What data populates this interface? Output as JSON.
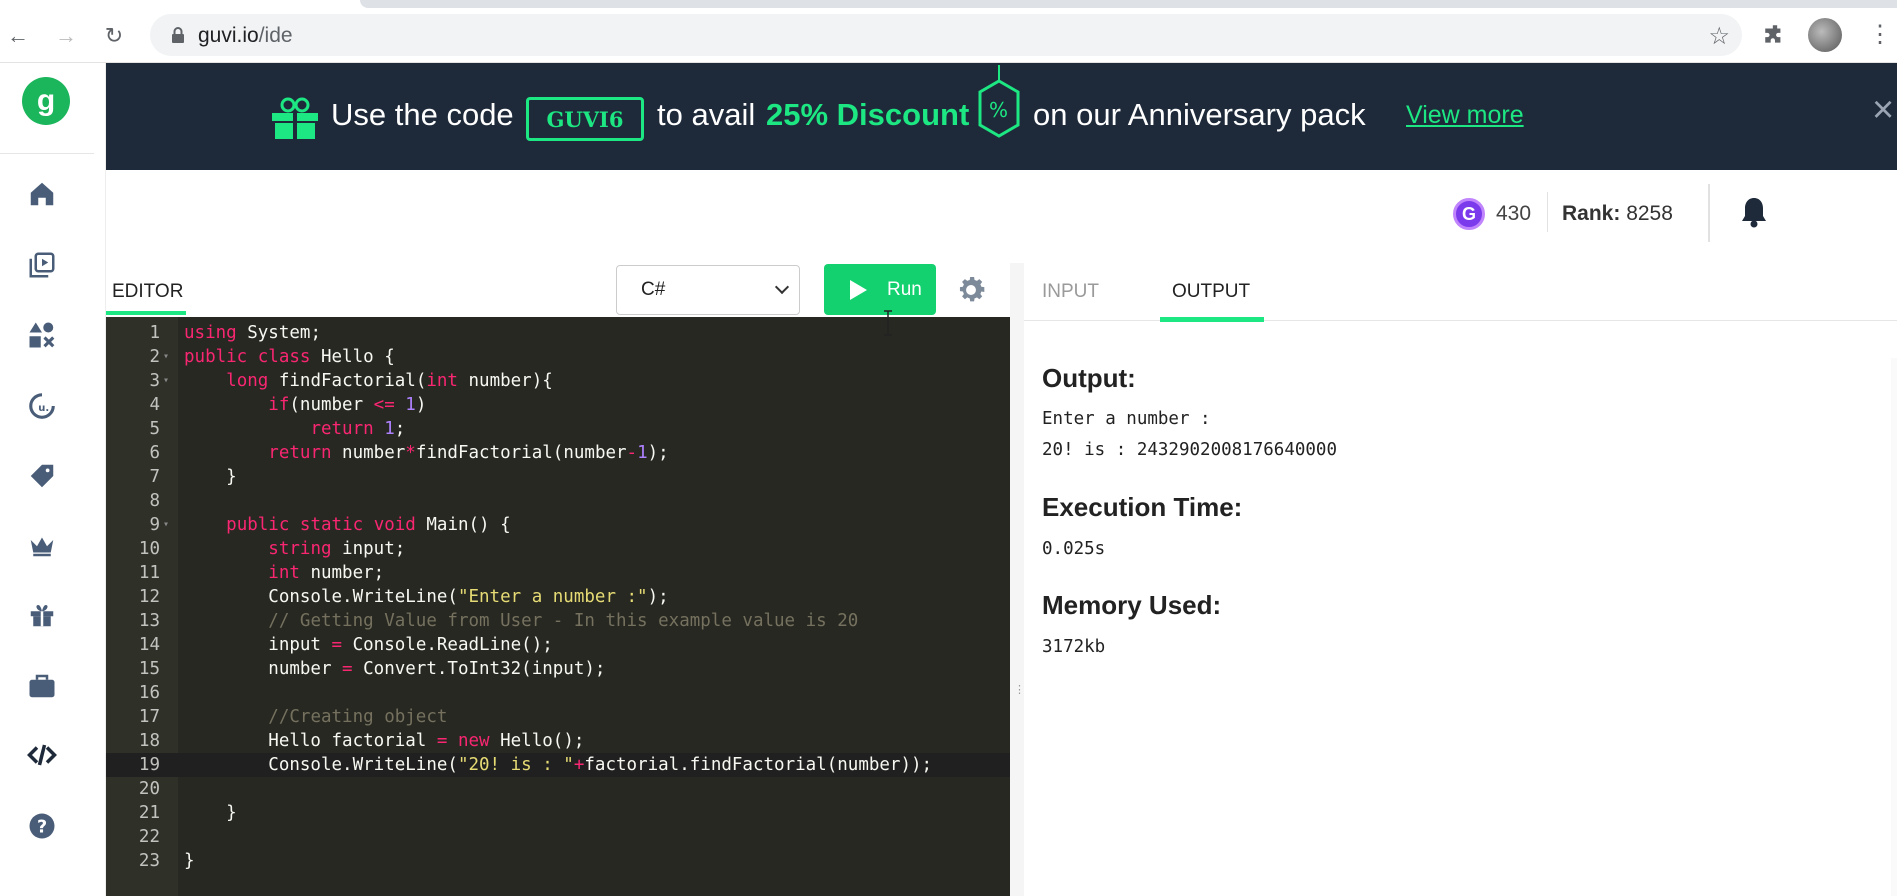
{
  "browser": {
    "url_host": "guvi.io",
    "url_path": "/ide"
  },
  "banner": {
    "text_before_code": "Use the code",
    "code": "GUVI6",
    "text_avail": "to avail",
    "discount": "25% Discount",
    "percent_symbol": "%",
    "text_after": "on our Anniversary pack",
    "view_more": "View more",
    "close": "×",
    "colors": {
      "background": "#1e2a3a",
      "accent": "#1de782"
    }
  },
  "stats": {
    "coin_letter": "G",
    "coins": "430",
    "rank_label": "Rank:",
    "rank_value": "8258"
  },
  "editor": {
    "tab_label": "EDITOR",
    "language": "C#",
    "run_label": "Run",
    "colors": {
      "background": "#272822",
      "run_button": "#14d170"
    },
    "lines": [
      {
        "n": "1",
        "fold": false,
        "tokens": [
          {
            "t": "kw",
            "v": "using"
          },
          {
            "t": "plain",
            "v": " System;"
          }
        ]
      },
      {
        "n": "2",
        "fold": true,
        "tokens": [
          {
            "t": "kw",
            "v": "public"
          },
          {
            "t": "plain",
            "v": " "
          },
          {
            "t": "kw",
            "v": "class"
          },
          {
            "t": "plain",
            "v": " Hello {"
          }
        ]
      },
      {
        "n": "3",
        "fold": true,
        "tokens": [
          {
            "t": "plain",
            "v": "    "
          },
          {
            "t": "kw",
            "v": "long"
          },
          {
            "t": "plain",
            "v": " findFactorial("
          },
          {
            "t": "kw",
            "v": "int"
          },
          {
            "t": "plain",
            "v": " number){"
          }
        ]
      },
      {
        "n": "4",
        "fold": false,
        "tokens": [
          {
            "t": "plain",
            "v": "        "
          },
          {
            "t": "kw",
            "v": "if"
          },
          {
            "t": "plain",
            "v": "(number "
          },
          {
            "t": "op",
            "v": "<="
          },
          {
            "t": "plain",
            "v": " "
          },
          {
            "t": "num",
            "v": "1"
          },
          {
            "t": "plain",
            "v": ")"
          }
        ]
      },
      {
        "n": "5",
        "fold": false,
        "tokens": [
          {
            "t": "plain",
            "v": "            "
          },
          {
            "t": "kw",
            "v": "return"
          },
          {
            "t": "plain",
            "v": " "
          },
          {
            "t": "num",
            "v": "1"
          },
          {
            "t": "plain",
            "v": ";"
          }
        ]
      },
      {
        "n": "6",
        "fold": false,
        "tokens": [
          {
            "t": "plain",
            "v": "        "
          },
          {
            "t": "kw",
            "v": "return"
          },
          {
            "t": "plain",
            "v": " number"
          },
          {
            "t": "op",
            "v": "*"
          },
          {
            "t": "plain",
            "v": "findFactorial(number"
          },
          {
            "t": "op",
            "v": "-"
          },
          {
            "t": "num",
            "v": "1"
          },
          {
            "t": "plain",
            "v": ");"
          }
        ]
      },
      {
        "n": "7",
        "fold": false,
        "tokens": [
          {
            "t": "plain",
            "v": "    }"
          }
        ]
      },
      {
        "n": "8",
        "fold": false,
        "tokens": []
      },
      {
        "n": "9",
        "fold": true,
        "tokens": [
          {
            "t": "plain",
            "v": "    "
          },
          {
            "t": "kw",
            "v": "public"
          },
          {
            "t": "plain",
            "v": " "
          },
          {
            "t": "kw",
            "v": "static"
          },
          {
            "t": "plain",
            "v": " "
          },
          {
            "t": "kw",
            "v": "void"
          },
          {
            "t": "plain",
            "v": " Main() {"
          }
        ]
      },
      {
        "n": "10",
        "fold": false,
        "tokens": [
          {
            "t": "plain",
            "v": "        "
          },
          {
            "t": "kw",
            "v": "string"
          },
          {
            "t": "plain",
            "v": " input;"
          }
        ]
      },
      {
        "n": "11",
        "fold": false,
        "tokens": [
          {
            "t": "plain",
            "v": "        "
          },
          {
            "t": "kw",
            "v": "int"
          },
          {
            "t": "plain",
            "v": " number;"
          }
        ]
      },
      {
        "n": "12",
        "fold": false,
        "tokens": [
          {
            "t": "plain",
            "v": "        Console.WriteLine("
          },
          {
            "t": "str",
            "v": "\"Enter a number :\""
          },
          {
            "t": "plain",
            "v": ");"
          }
        ]
      },
      {
        "n": "13",
        "fold": false,
        "tokens": [
          {
            "t": "plain",
            "v": "        "
          },
          {
            "t": "cm",
            "v": "// Getting Value from User - In this example value is 20"
          }
        ]
      },
      {
        "n": "14",
        "fold": false,
        "tokens": [
          {
            "t": "plain",
            "v": "        input "
          },
          {
            "t": "op",
            "v": "="
          },
          {
            "t": "plain",
            "v": " Console.ReadLine();"
          }
        ]
      },
      {
        "n": "15",
        "fold": false,
        "tokens": [
          {
            "t": "plain",
            "v": "        number "
          },
          {
            "t": "op",
            "v": "="
          },
          {
            "t": "plain",
            "v": " Convert.ToInt32(input);"
          }
        ]
      },
      {
        "n": "16",
        "fold": false,
        "tokens": []
      },
      {
        "n": "17",
        "fold": false,
        "tokens": [
          {
            "t": "plain",
            "v": "        "
          },
          {
            "t": "cm",
            "v": "//Creating object"
          }
        ]
      },
      {
        "n": "18",
        "fold": false,
        "tokens": [
          {
            "t": "plain",
            "v": "        Hello factorial "
          },
          {
            "t": "op",
            "v": "="
          },
          {
            "t": "plain",
            "v": " "
          },
          {
            "t": "kw",
            "v": "new"
          },
          {
            "t": "plain",
            "v": " Hello();"
          }
        ]
      },
      {
        "n": "19",
        "fold": false,
        "active": true,
        "tokens": [
          {
            "t": "plain",
            "v": "        Console.WriteLine("
          },
          {
            "t": "str",
            "v": "\"20! is : \""
          },
          {
            "t": "op",
            "v": "+"
          },
          {
            "t": "plain",
            "v": "factorial.findFactorial(number));"
          }
        ]
      },
      {
        "n": "20",
        "fold": false,
        "tokens": []
      },
      {
        "n": "21",
        "fold": false,
        "tokens": [
          {
            "t": "plain",
            "v": "    }"
          }
        ]
      },
      {
        "n": "22",
        "fold": false,
        "tokens": []
      },
      {
        "n": "23",
        "fold": false,
        "tokens": [
          {
            "t": "plain",
            "v": "}"
          }
        ]
      }
    ]
  },
  "io": {
    "tab_input": "INPUT",
    "tab_output": "OUTPUT",
    "output_title": "Output:",
    "output_line1": "Enter a number :",
    "output_line2": "20! is : 2432902008176640000",
    "exec_title": "Execution Time:",
    "exec_value": "0.025s",
    "memory_title": "Memory Used:",
    "memory_value": "3172kb"
  },
  "sidebar_icons": [
    "home-icon",
    "video-library-icon",
    "shapes-icon",
    "badge-icon",
    "tag-icon",
    "crown-icon",
    "gift-icon",
    "briefcase-icon",
    "code-icon",
    "help-icon"
  ]
}
